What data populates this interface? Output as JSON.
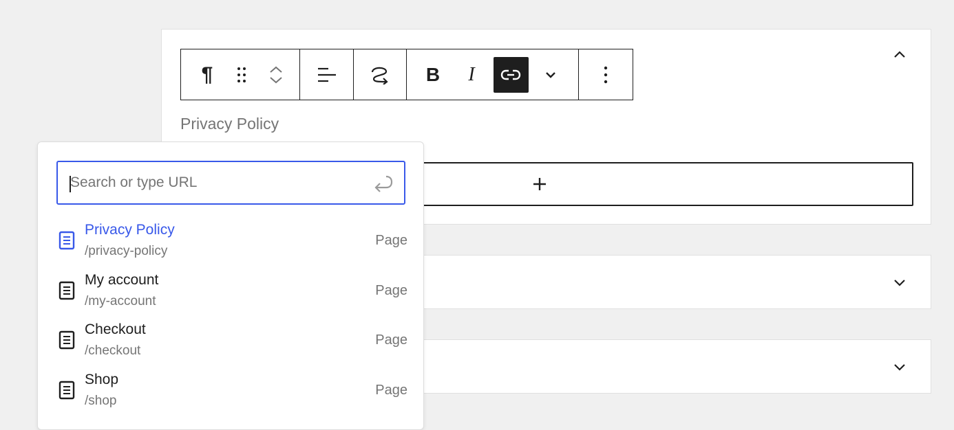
{
  "editor": {
    "block_text": "Privacy Policy",
    "toolbar": {
      "paragraph_icon": "¶",
      "bold_label": "B",
      "italic_label": "I"
    }
  },
  "link_popover": {
    "search_placeholder": "Search or type URL",
    "search_value": "",
    "results": [
      {
        "title": "Privacy Policy",
        "url": "/privacy-policy",
        "type": "Page",
        "selected": true
      },
      {
        "title": "My account",
        "url": "/my-account",
        "type": "Page",
        "selected": false
      },
      {
        "title": "Checkout",
        "url": "/checkout",
        "type": "Page",
        "selected": false
      },
      {
        "title": "Shop",
        "url": "/shop",
        "type": "Page",
        "selected": false
      }
    ]
  },
  "colors": {
    "accent": "#3858e9",
    "text": "#1e1e1e",
    "muted": "#757575",
    "background": "#f0f0f0"
  }
}
